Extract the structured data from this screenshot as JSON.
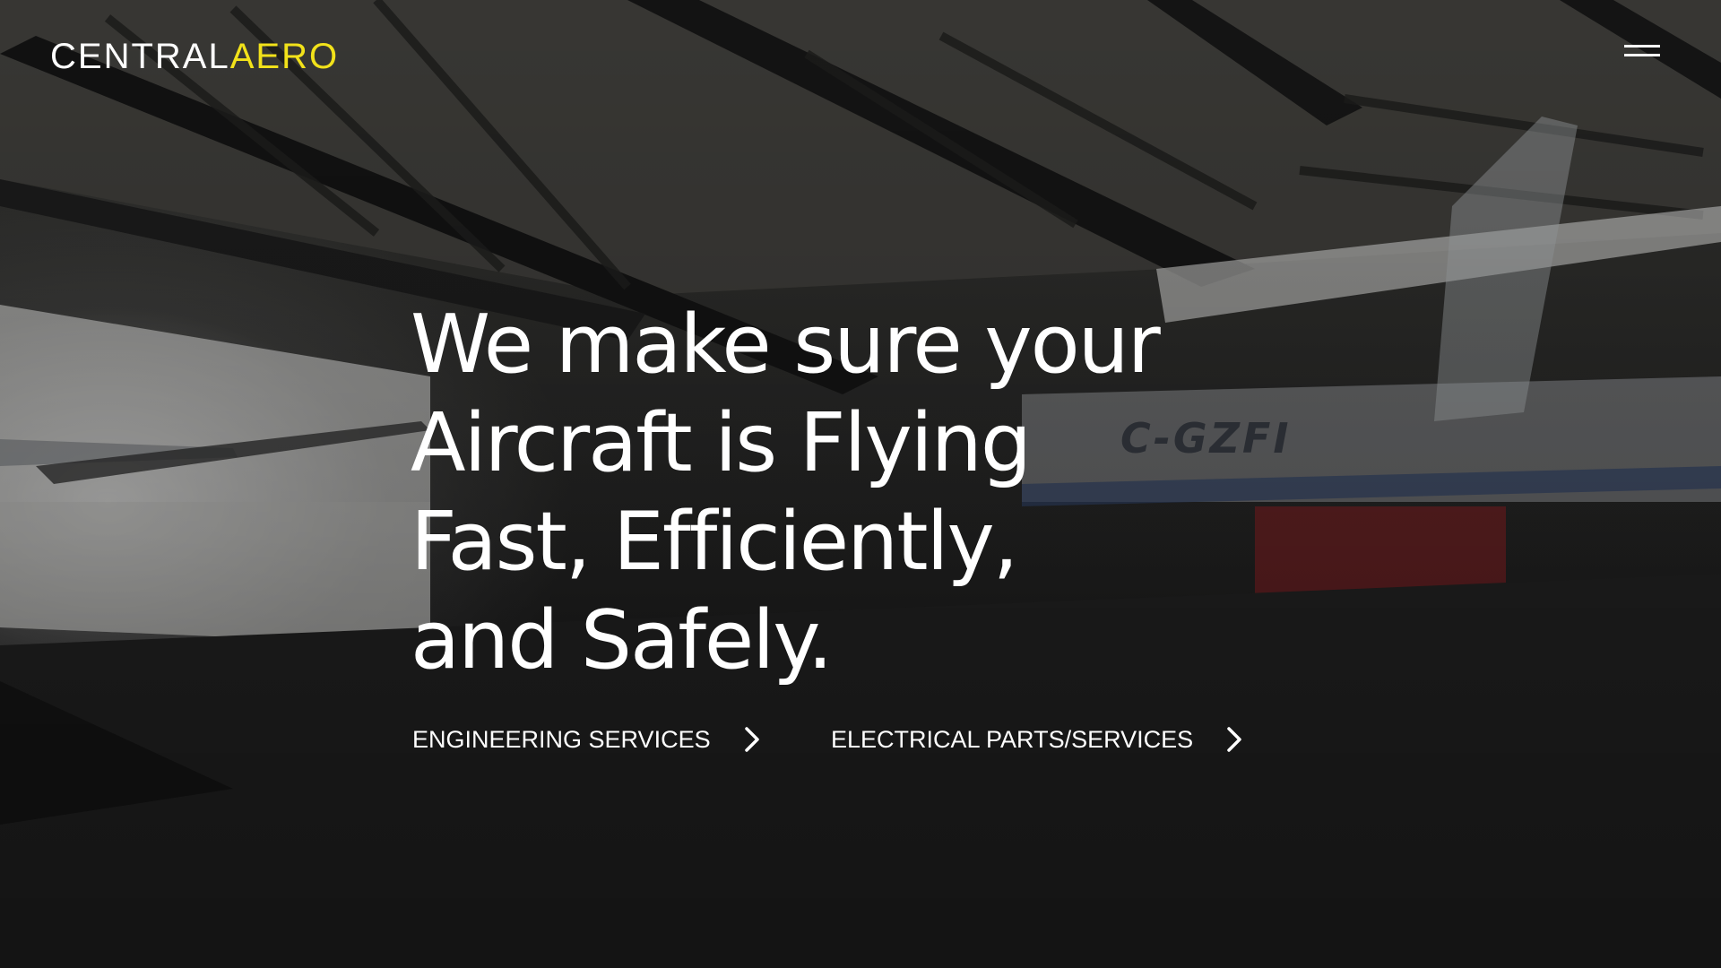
{
  "header": {
    "logo_primary": "CENTRAL",
    "logo_accent": "AERO",
    "menu_icon": "hamburger-menu-icon"
  },
  "hero": {
    "headline_lines": [
      "We make sure your",
      "Aircraft is Flying",
      "Fast, Efficiently,",
      "and Safely."
    ],
    "background_text": "C-GZFI",
    "links": [
      {
        "label": "ENGINEERING SERVICES",
        "icon": "chevron-right-icon"
      },
      {
        "label": "ELECTRICAL PARTS/SERVICES",
        "icon": "chevron-right-icon"
      }
    ]
  },
  "colors": {
    "accent": "#f2e21a",
    "text": "#ffffff",
    "background": "#1c1c1c"
  }
}
